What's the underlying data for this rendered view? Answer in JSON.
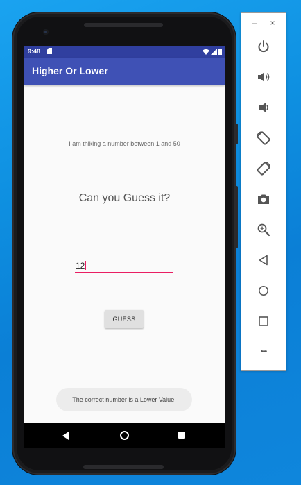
{
  "status_bar": {
    "time": "9:48"
  },
  "app": {
    "title": "Higher Or Lower"
  },
  "main": {
    "prompt": "I am thiking a number between 1 and 50",
    "question": "Can you Guess it?",
    "guess_input_value": "12",
    "guess_button_label": "GUESS",
    "toast_message": "The correct number is a Lower Value!"
  },
  "emulator_toolbar": {
    "minimize_label": "–",
    "close_label": "×",
    "more_label": "•••",
    "buttons": [
      "power-icon",
      "volume-up-icon",
      "volume-down-icon",
      "rotate-left-icon",
      "rotate-right-icon",
      "camera-icon",
      "zoom-icon",
      "back-icon",
      "home-icon",
      "overview-icon",
      "more-icon"
    ]
  },
  "colors": {
    "status_bar": "#303f9f",
    "app_bar": "#3f51b5",
    "accent": "#e91e63",
    "toolbar_icon": "#555555",
    "desktop_background": "#0e8fe0"
  }
}
